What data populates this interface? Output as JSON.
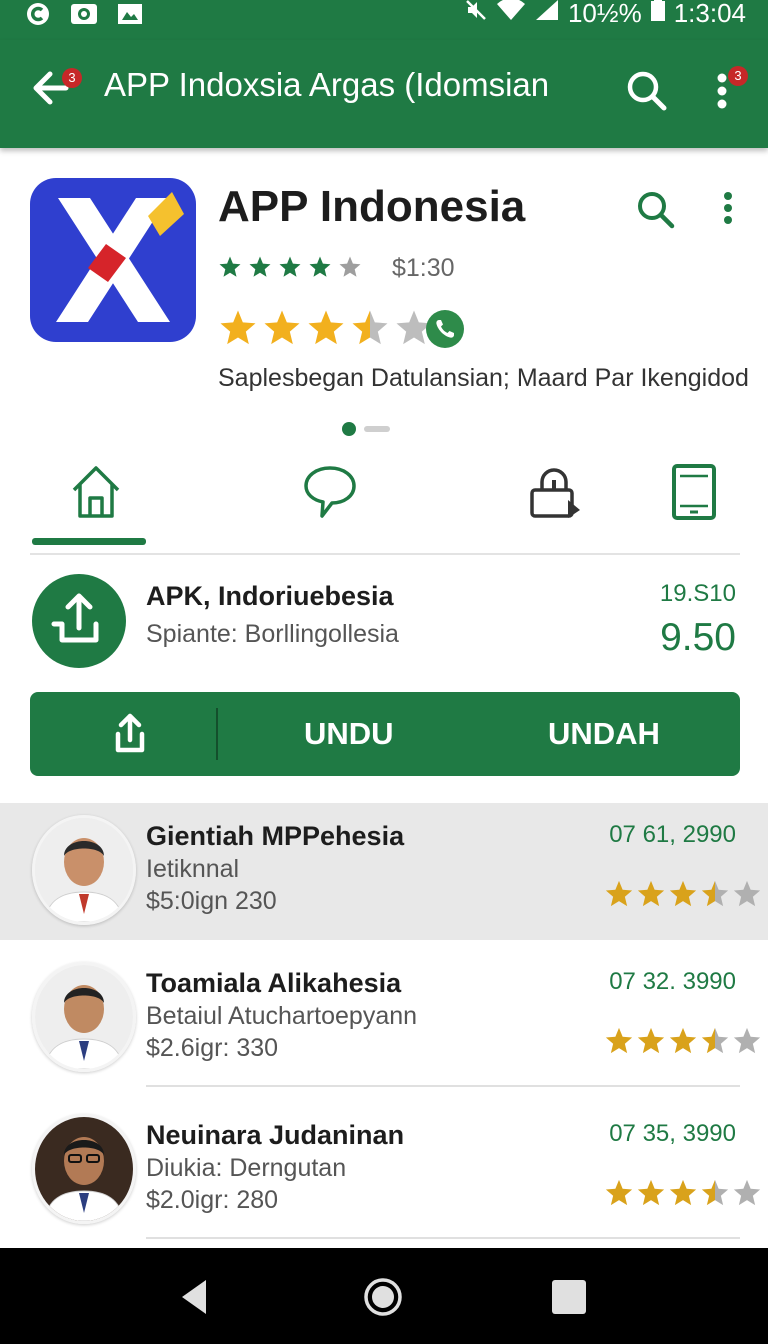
{
  "status_bar": {
    "battery_pct": "10½%",
    "time": "1:3:04",
    "icons": [
      "notification-icon",
      "camera-icon",
      "gallery-icon",
      "mute-icon",
      "wifi-icon",
      "signal-icon",
      "battery-icon"
    ]
  },
  "app_bar": {
    "title": "APP Indoxsia Argas (Idomsian",
    "back_badge": "3",
    "menu_badge": "3"
  },
  "hero": {
    "title": "APP Indonesia",
    "price": "$1:30",
    "subtitle": "Saplesbegan Datulansian; Maard Par Ikengidod",
    "green_rating": 4,
    "gold_rating": 3.5
  },
  "tabs": [
    {
      "icon": "home-icon",
      "selected": true
    },
    {
      "icon": "chat-icon",
      "selected": false
    },
    {
      "icon": "lock-icon",
      "selected": false
    },
    {
      "icon": "tablet-icon",
      "selected": false
    }
  ],
  "featured": {
    "title": "APK, Indoriuebesia",
    "subtitle": "Spiante: Borllingollesia",
    "small_value": "19.S10",
    "big_value": "9.50"
  },
  "actions": {
    "left_label": "UNDU",
    "right_label": "UNDAH"
  },
  "list": [
    {
      "name": "Gientiah MPPehesia",
      "role": "Ietiknnal",
      "price": "$5:0ign 230",
      "date": "07 61, 2990",
      "rating": 3.5,
      "highlighted": true
    },
    {
      "name": "Toamiala Alikahesia",
      "role": "Betaiul Atuchartoepyann",
      "price": "$2.6igr: 330",
      "date": "07 32. 3990",
      "rating": 3.5,
      "highlighted": false
    },
    {
      "name": "Neuinara Judaninan",
      "role": "Diukia: Derngutan",
      "price": "$2.0igr: 280",
      "date": "07 35, 3990",
      "rating": 3.5,
      "highlighted": false
    }
  ],
  "colors": {
    "primary": "#1f7a44",
    "gold": "#f2b01e",
    "badge": "#c62828",
    "icon_blue": "#2f3fcf",
    "icon_yellow": "#f5c12e",
    "icon_red": "#d6242a"
  }
}
